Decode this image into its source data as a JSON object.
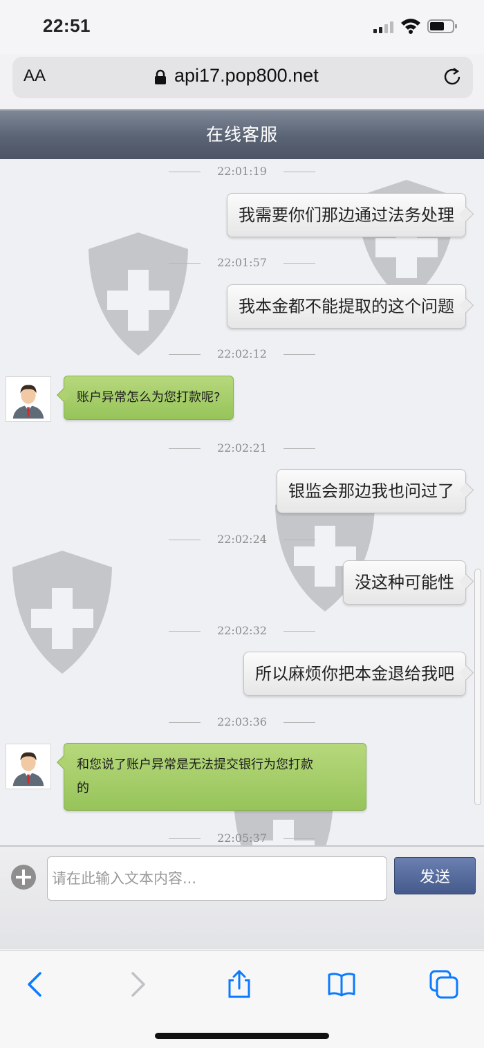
{
  "status_bar": {
    "time": "22:51"
  },
  "browser": {
    "text_size_label": "AA",
    "url": "api17.pop800.net"
  },
  "header": {
    "title": "在线客服"
  },
  "messages": [
    {
      "side": "right",
      "time": "22:01:19",
      "text": "我需要你们那边通过法务处理"
    },
    {
      "side": "right",
      "time": "22:01:57",
      "text": "我本金都不能提取的这个问题"
    },
    {
      "side": "left",
      "time": "22:02:12",
      "text": "账户异常怎么为您打款呢?"
    },
    {
      "side": "right",
      "time": "22:02:21",
      "text": "银监会那边我也问过了"
    },
    {
      "side": "right",
      "time": "22:02:24",
      "text": "没这种可能性"
    },
    {
      "side": "right",
      "time": "22:02:32",
      "text": "所以麻烦你把本金退给我吧"
    },
    {
      "side": "left",
      "time": "22:03:36",
      "text_line1": "和您说了账户异常是无法提交银行为您打款",
      "text_line2": "的"
    },
    {
      "side": "right",
      "time": "22:05:37"
    }
  ],
  "input": {
    "placeholder": "请在此输入文本内容...",
    "value": ""
  },
  "send_button": {
    "label": "发送"
  },
  "icons": {
    "back": "chevron-left-icon",
    "forward": "chevron-right-icon",
    "share": "share-icon",
    "bookmarks": "book-icon",
    "tabs": "tabs-icon",
    "attach": "plus-circle-icon",
    "lock": "lock-icon",
    "reload": "reload-icon",
    "watermark": "shield-plus-icon"
  },
  "colors": {
    "accent": "#0a7aff",
    "header": "#5a6374",
    "agent_bubble": "#a6cd68",
    "send_button": "#4f6596"
  }
}
